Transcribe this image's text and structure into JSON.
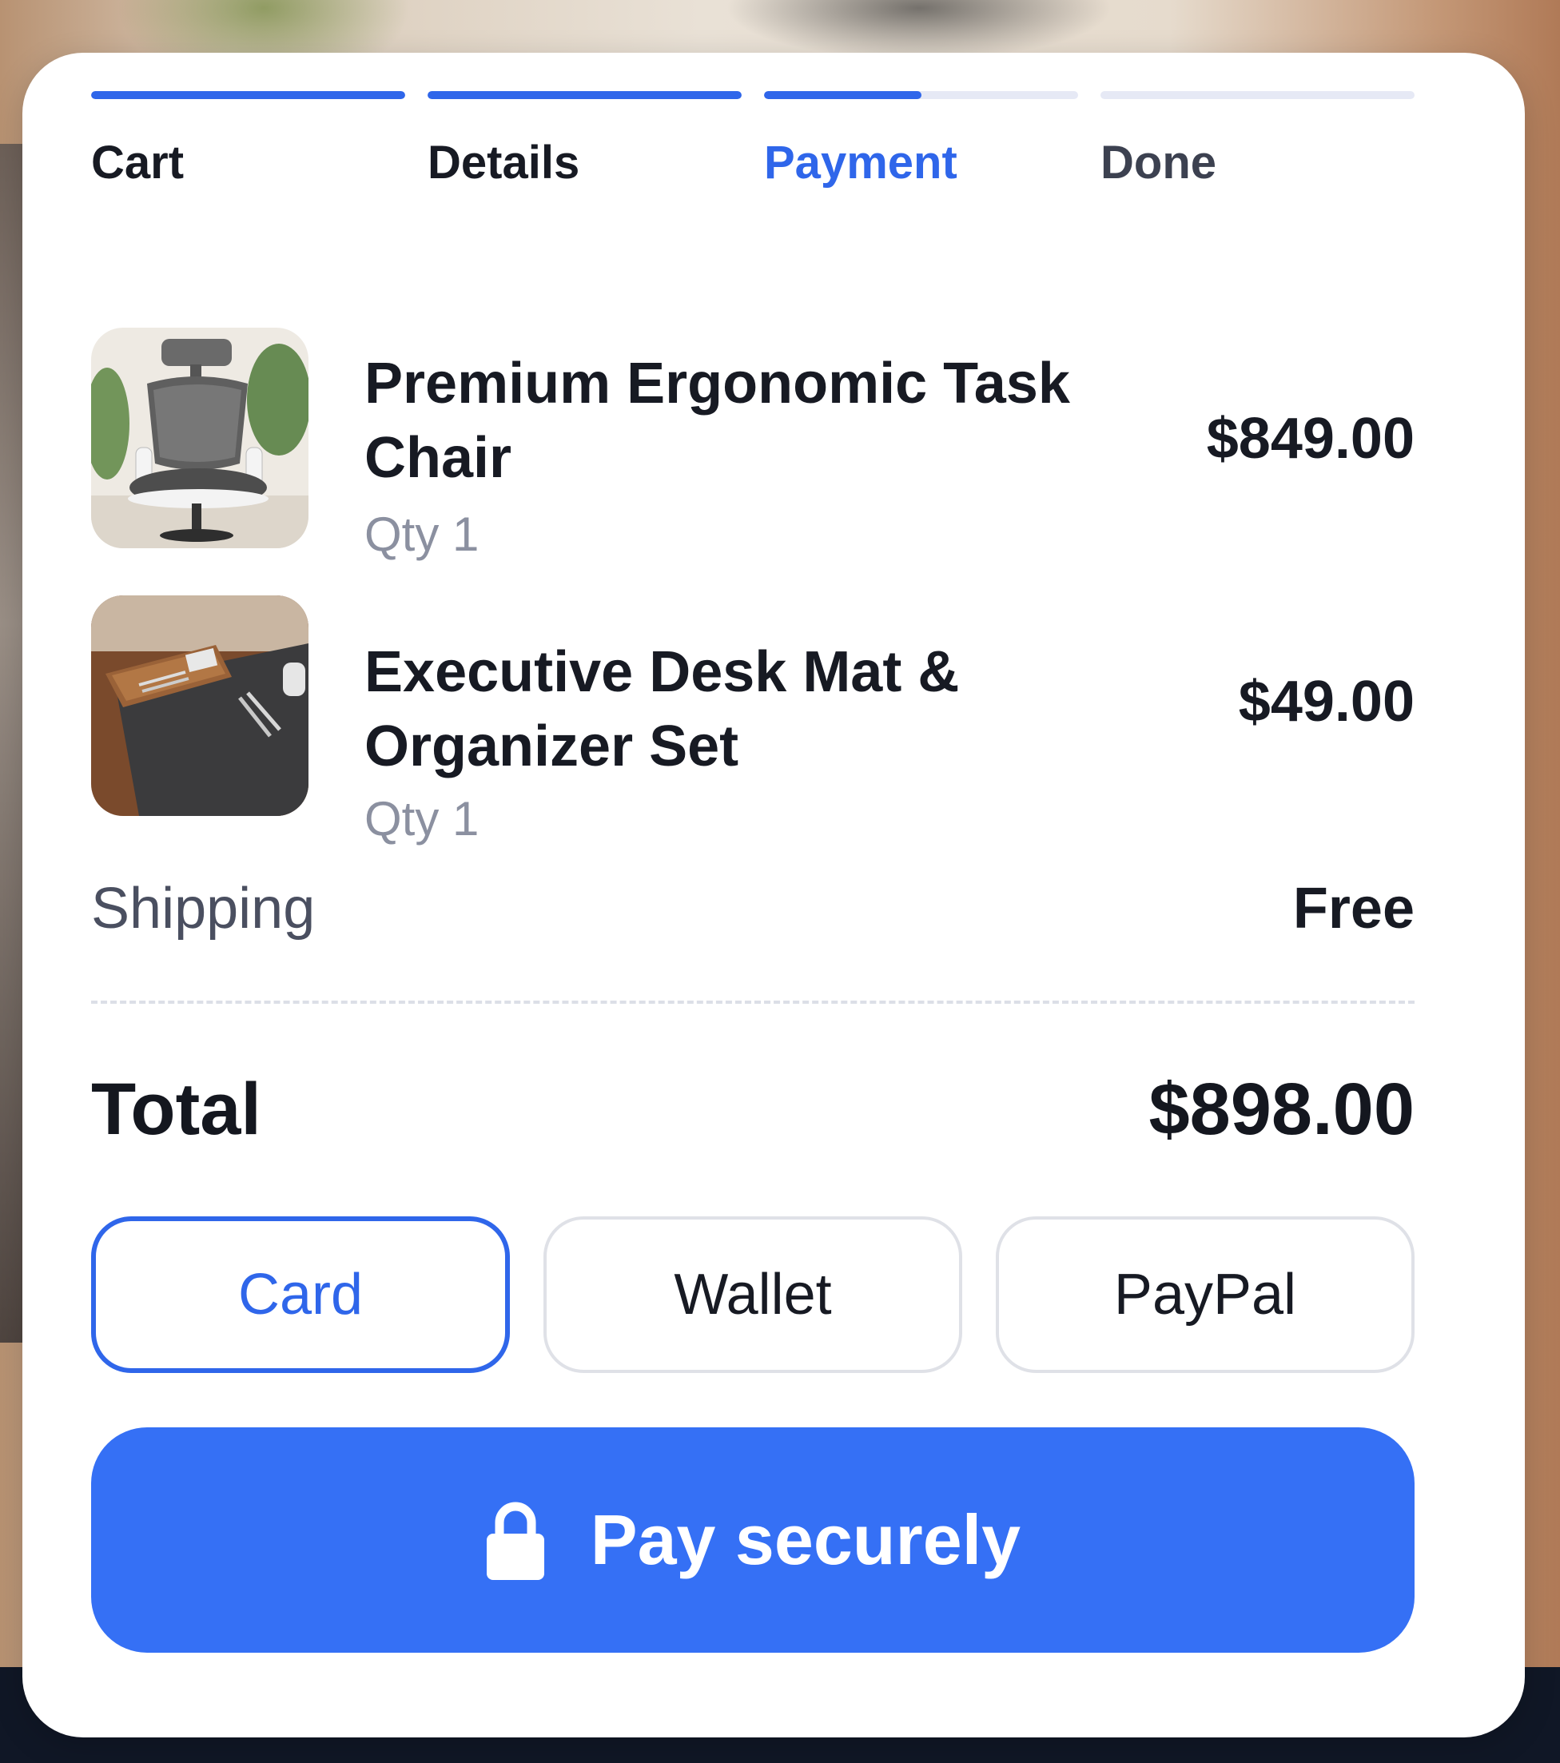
{
  "steps": [
    {
      "label": "Cart",
      "state": "complete",
      "progress": 1.0
    },
    {
      "label": "Details",
      "state": "complete",
      "progress": 1.0
    },
    {
      "label": "Payment",
      "state": "active",
      "progress": 0.5
    },
    {
      "label": "Done",
      "state": "pending",
      "progress": 0.0
    }
  ],
  "items": [
    {
      "name": "Premium Ergonomic Task Chair",
      "qty": "Qty 1",
      "price": "$849.00",
      "thumbnail": "office-chair-image"
    },
    {
      "name": "Executive Desk Mat & Organizer Set",
      "qty": "Qty 1",
      "price": "$49.00",
      "thumbnail": "desk-mat-image"
    }
  ],
  "shipping": {
    "label": "Shipping",
    "value": "Free"
  },
  "total": {
    "label": "Total",
    "value": "$898.00"
  },
  "payment_methods": [
    {
      "label": "Card",
      "selected": true
    },
    {
      "label": "Wallet",
      "selected": false
    },
    {
      "label": "PayPal",
      "selected": false
    }
  ],
  "pay_button": {
    "label": "Pay securely",
    "icon": "lock-icon"
  },
  "colors": {
    "accent": "#2f66ea",
    "button": "#3570f5",
    "track": "#e6e9f5",
    "text": "#171a23",
    "muted": "#8b90a0"
  }
}
